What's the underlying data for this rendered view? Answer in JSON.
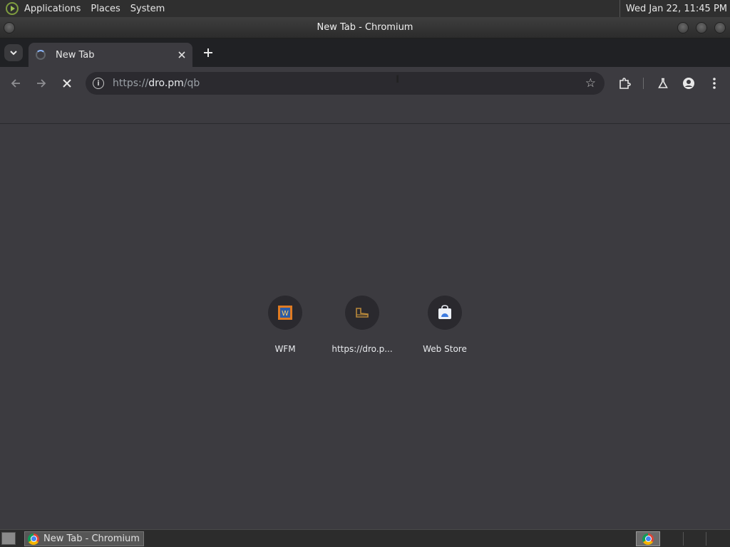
{
  "system_bar": {
    "menus": [
      "Applications",
      "Places",
      "System"
    ],
    "clock": "Wed Jan 22, 11:45 PM"
  },
  "window": {
    "title": "New Tab - Chromium"
  },
  "tabs": [
    {
      "title": "New Tab",
      "loading": true
    }
  ],
  "toolbar": {
    "url_scheme": "https://",
    "url_host": "dro.pm",
    "url_path": "/qb"
  },
  "shortcuts": [
    {
      "label": "WFM",
      "icon": "wfm-favicon"
    },
    {
      "label": "https://dro.p...",
      "icon": "dro-favicon"
    },
    {
      "label": "Web Store",
      "icon": "web-store-icon"
    }
  ],
  "taskbar": {
    "tasks": [
      {
        "label": "New Tab - Chromium",
        "icon": "chromium-icon"
      }
    ]
  },
  "colors": {
    "page_bg": "#3c3b40",
    "tabstrip_bg": "#202124",
    "omnibox_bg": "#2b2a2f"
  }
}
